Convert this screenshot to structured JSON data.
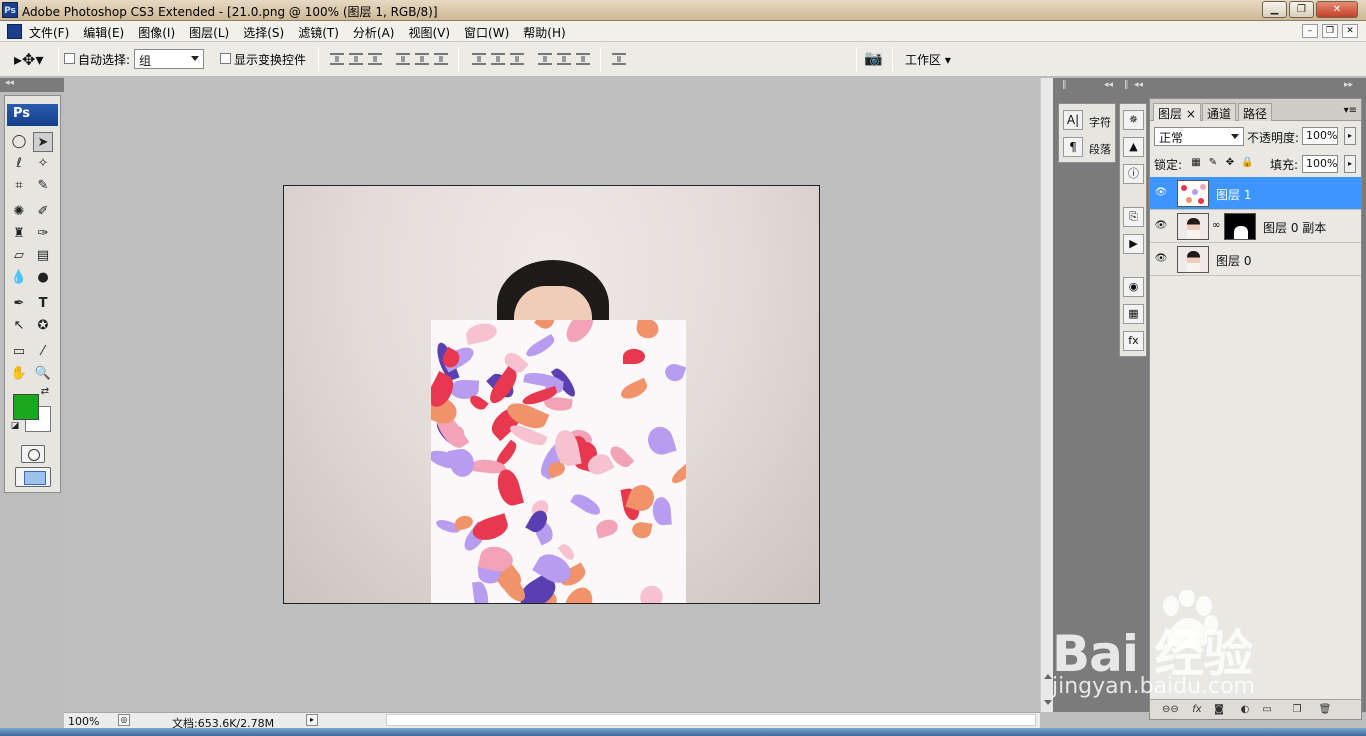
{
  "window": {
    "title": "Adobe Photoshop CS3 Extended - [21.0.png @ 100% (图层 1, RGB/8)]",
    "app_icon": "Ps"
  },
  "menu": [
    "文件(F)",
    "编辑(E)",
    "图像(I)",
    "图层(L)",
    "选择(S)",
    "滤镜(T)",
    "分析(A)",
    "视图(V)",
    "窗口(W)",
    "帮助(H)"
  ],
  "options": {
    "auto_select_label": "自动选择:",
    "auto_select_value": "组",
    "show_transform_label": "显示变换控件",
    "workspace_label": "工作区"
  },
  "toolbox": {
    "logo": "Ps",
    "foreground_color": "#19a81e",
    "background_color": "#ffffff"
  },
  "status": {
    "zoom": "100%",
    "doc_info": "文档:653.6K/2.78M"
  },
  "mini_panel": {
    "items": [
      {
        "icon": "character-icon",
        "glyph": "A|",
        "label": "字符"
      },
      {
        "icon": "paragraph-icon",
        "glyph": "¶",
        "label": "段落"
      }
    ]
  },
  "layers_panel": {
    "tabs": [
      {
        "label": "图层",
        "active": true
      },
      {
        "label": "通道",
        "active": false
      },
      {
        "label": "路径",
        "active": false
      }
    ],
    "blend_mode": "正常",
    "opacity_label": "不透明度:",
    "opacity_value": "100%",
    "lock_label": "锁定:",
    "fill_label": "填充:",
    "fill_value": "100%",
    "layers": [
      {
        "name": "图层 1",
        "selected": true,
        "has_mask": false
      },
      {
        "name": "图层 0 副本",
        "selected": false,
        "has_mask": true
      },
      {
        "name": "图层 0",
        "selected": false,
        "has_mask": false
      }
    ]
  },
  "watermark": {
    "brand": "Bai  经验",
    "url": "jingyan.baidu.com"
  }
}
